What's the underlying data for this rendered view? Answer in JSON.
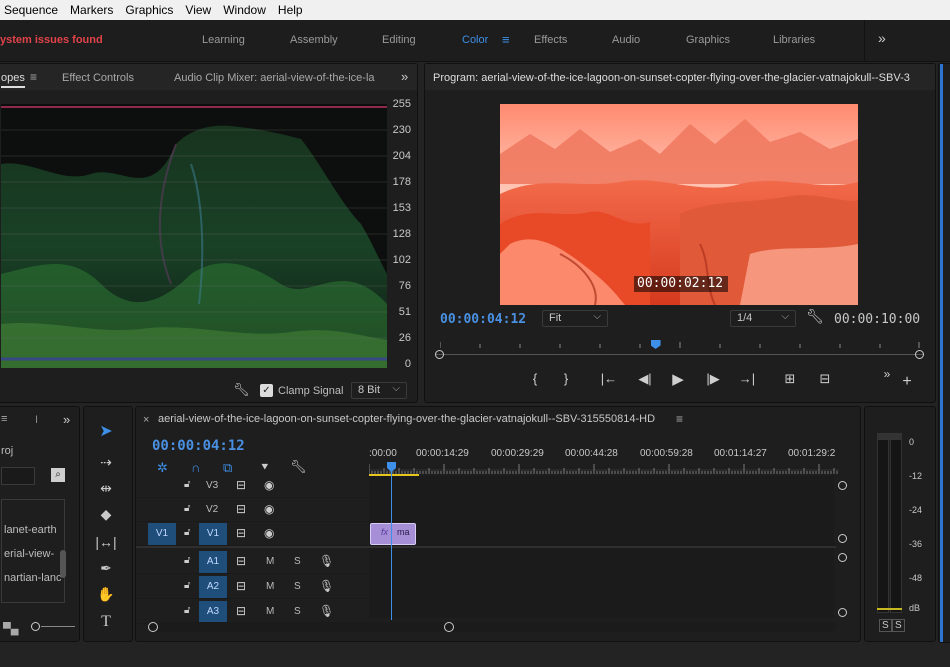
{
  "menubar": {
    "items": [
      "Sequence",
      "Markers",
      "Graphics",
      "View",
      "Window",
      "Help"
    ]
  },
  "workspace": {
    "alert": "ystem issues found",
    "tabs": [
      "Learning",
      "Assembly",
      "Editing",
      "Color",
      "Effects",
      "Audio",
      "Graphics",
      "Libraries"
    ],
    "active_tab": "Color",
    "more": "»"
  },
  "scopes": {
    "tabs": [
      "opes",
      "Effect Controls",
      "Audio Clip Mixer: aerial-view-of-the-ice-la"
    ],
    "more": "»",
    "scale": [
      "255",
      "230",
      "204",
      "178",
      "153",
      "128",
      "102",
      "76",
      "51",
      "26",
      "0"
    ],
    "clamp_label": "Clamp Signal",
    "clamp_checked": true,
    "bit_depth": "8 Bit"
  },
  "program": {
    "title": "Program: aerial-view-of-the-ice-lagoon-on-sunset-copter-flying-over-the-glacier-vatnajokull--SBV-3",
    "overlay_timecode": "00:00:02:12",
    "current_timecode": "00:00:04:12",
    "fit": "Fit",
    "resolution": "1/4",
    "duration": "00:00:10:00",
    "playhead_fraction": 0.45,
    "controls": [
      "{",
      "}",
      "|←",
      "◀|",
      "▶",
      "|▶",
      "→|",
      "⊞",
      "⊟"
    ]
  },
  "project": {
    "tab_partial": "I",
    "more": "»",
    "proj_label": "roj",
    "items": [
      "lanet-earth",
      "erial-view-",
      "nartian-lanc"
    ]
  },
  "tools": [
    "selection-tool",
    "track-select-tool",
    "ripple-edit-tool",
    "razor-tool",
    "slip-tool",
    "pen-tool",
    "hand-tool",
    "type-tool"
  ],
  "timeline": {
    "close": "×",
    "sequence_name": "aerial-view-of-the-ice-lagoon-on-sunset-copter-flying-over-the-glacier-vatnajokull--SBV-315550814-HD",
    "menu": "≡",
    "timecode": "00:00:04:12",
    "ruler": [
      ":00:00",
      "00:00:14:29",
      "00:00:29:29",
      "00:00:44:28",
      "00:00:59:28",
      "00:01:14:27",
      "00:01:29:2"
    ],
    "video_tracks": [
      {
        "name": "V3",
        "source": ""
      },
      {
        "name": "V2",
        "source": ""
      },
      {
        "name": "V1",
        "source": "V1"
      }
    ],
    "audio_tracks": [
      {
        "name": "A1",
        "mute": "M",
        "solo": "S"
      },
      {
        "name": "A2",
        "mute": "M",
        "solo": "S"
      },
      {
        "name": "A3",
        "mute": "M",
        "solo": "S"
      }
    ],
    "clip": {
      "fx": "fx",
      "label": "ma"
    }
  },
  "meter": {
    "scale": [
      "0",
      "-12",
      "-24",
      "-36",
      "-48",
      "dB"
    ],
    "solo": [
      "S",
      "S"
    ]
  }
}
